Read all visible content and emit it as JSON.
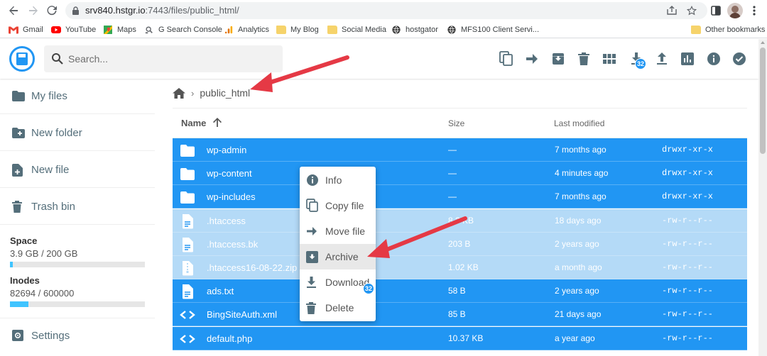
{
  "browser": {
    "url_host": "srv840.hstgr.io",
    "url_rest": ":7443/files/public_html/",
    "bookmarks": [
      {
        "label": "Gmail",
        "icon": "gmail-icon",
        "color": "#ea4335"
      },
      {
        "label": "YouTube",
        "icon": "youtube-icon",
        "color": "#ff0000"
      },
      {
        "label": "Maps",
        "icon": "maps-icon",
        "color": "#34a853"
      },
      {
        "label": "G Search Console",
        "icon": "search-console-icon",
        "color": "#5f6368"
      },
      {
        "label": "Analytics",
        "icon": "analytics-icon",
        "color": "#f9ab00"
      },
      {
        "label": "My Blog",
        "icon": "folder-icon",
        "color": "#f6d36b"
      },
      {
        "label": "Social Media",
        "icon": "folder-icon",
        "color": "#f6d36b"
      },
      {
        "label": "hostgator",
        "icon": "globe-icon",
        "color": "#333333"
      },
      {
        "label": "MFS100 Client Servi...",
        "icon": "globe-icon",
        "color": "#333333"
      },
      {
        "label": "Other bookmarks",
        "icon": "folder-icon",
        "color": "#f6d36b"
      }
    ]
  },
  "header": {
    "search_placeholder": "Search...",
    "download_badge": "32",
    "accent_color": "#2196f3"
  },
  "sidebar": {
    "items": [
      {
        "label": "My files",
        "icon": "folder-icon"
      },
      {
        "label": "New folder",
        "icon": "new-folder-icon"
      },
      {
        "label": "New file",
        "icon": "new-file-icon"
      },
      {
        "label": "Trash bin",
        "icon": "trash-icon"
      }
    ],
    "space": {
      "title": "Space",
      "value": "3.9 GB / 200 GB",
      "fraction": 0.0195
    },
    "inodes": {
      "title": "Inodes",
      "value": "82694 / 600000",
      "fraction": 0.138
    },
    "settings_label": "Settings"
  },
  "breadcrumb": {
    "current": "public_html"
  },
  "columns": {
    "name": "Name",
    "size": "Size",
    "modified": "Last modified"
  },
  "files": [
    {
      "name": "wp-admin",
      "type": "folder",
      "size": "—",
      "modified": "7 months ago",
      "perm": "drwxr-xr-x",
      "state": "selected"
    },
    {
      "name": "wp-content",
      "type": "folder",
      "size": "—",
      "modified": "4 minutes ago",
      "perm": "drwxr-xr-x",
      "state": "selected"
    },
    {
      "name": "wp-includes",
      "type": "folder",
      "size": "—",
      "modified": "7 months ago",
      "perm": "drwxr-xr-x",
      "state": "selected"
    },
    {
      "name": ".htaccess",
      "type": "file",
      "size": "8.? KB",
      "modified": "18 days ago",
      "perm": "-rw-r--r--",
      "state": "dim"
    },
    {
      "name": ".htaccess.bk",
      "type": "file",
      "size": "203 B",
      "modified": "2 years ago",
      "perm": "-rw-r--r--",
      "state": "dim"
    },
    {
      "name": ".htaccess16-08-22.zip",
      "type": "archive",
      "size": "1.02 KB",
      "modified": "a month ago",
      "perm": "-rw-r--r--",
      "state": "dim"
    },
    {
      "name": "ads.txt",
      "type": "file",
      "size": "58 B",
      "modified": "2 years ago",
      "perm": "-rw-r--r--",
      "state": "selected"
    },
    {
      "name": "BingSiteAuth.xml",
      "type": "code",
      "size": "85 B",
      "modified": "21 days ago",
      "perm": "-rw-r--r--",
      "state": "selected"
    },
    {
      "name": "default.php",
      "type": "code",
      "size": "10.37 KB",
      "modified": "a year ago",
      "perm": "-rw-r--r--",
      "state": "selected"
    }
  ],
  "context_menu": {
    "items": [
      {
        "label": "Info",
        "icon": "info-icon"
      },
      {
        "label": "Copy file",
        "icon": "copy-icon"
      },
      {
        "label": "Move file",
        "icon": "move-icon"
      },
      {
        "label": "Archive",
        "icon": "archive-icon"
      },
      {
        "label": "Download",
        "icon": "download-icon"
      },
      {
        "label": "Delete",
        "icon": "delete-icon"
      }
    ],
    "badge": "32",
    "highlighted": "Archive"
  },
  "annotation_color": "#e53945"
}
